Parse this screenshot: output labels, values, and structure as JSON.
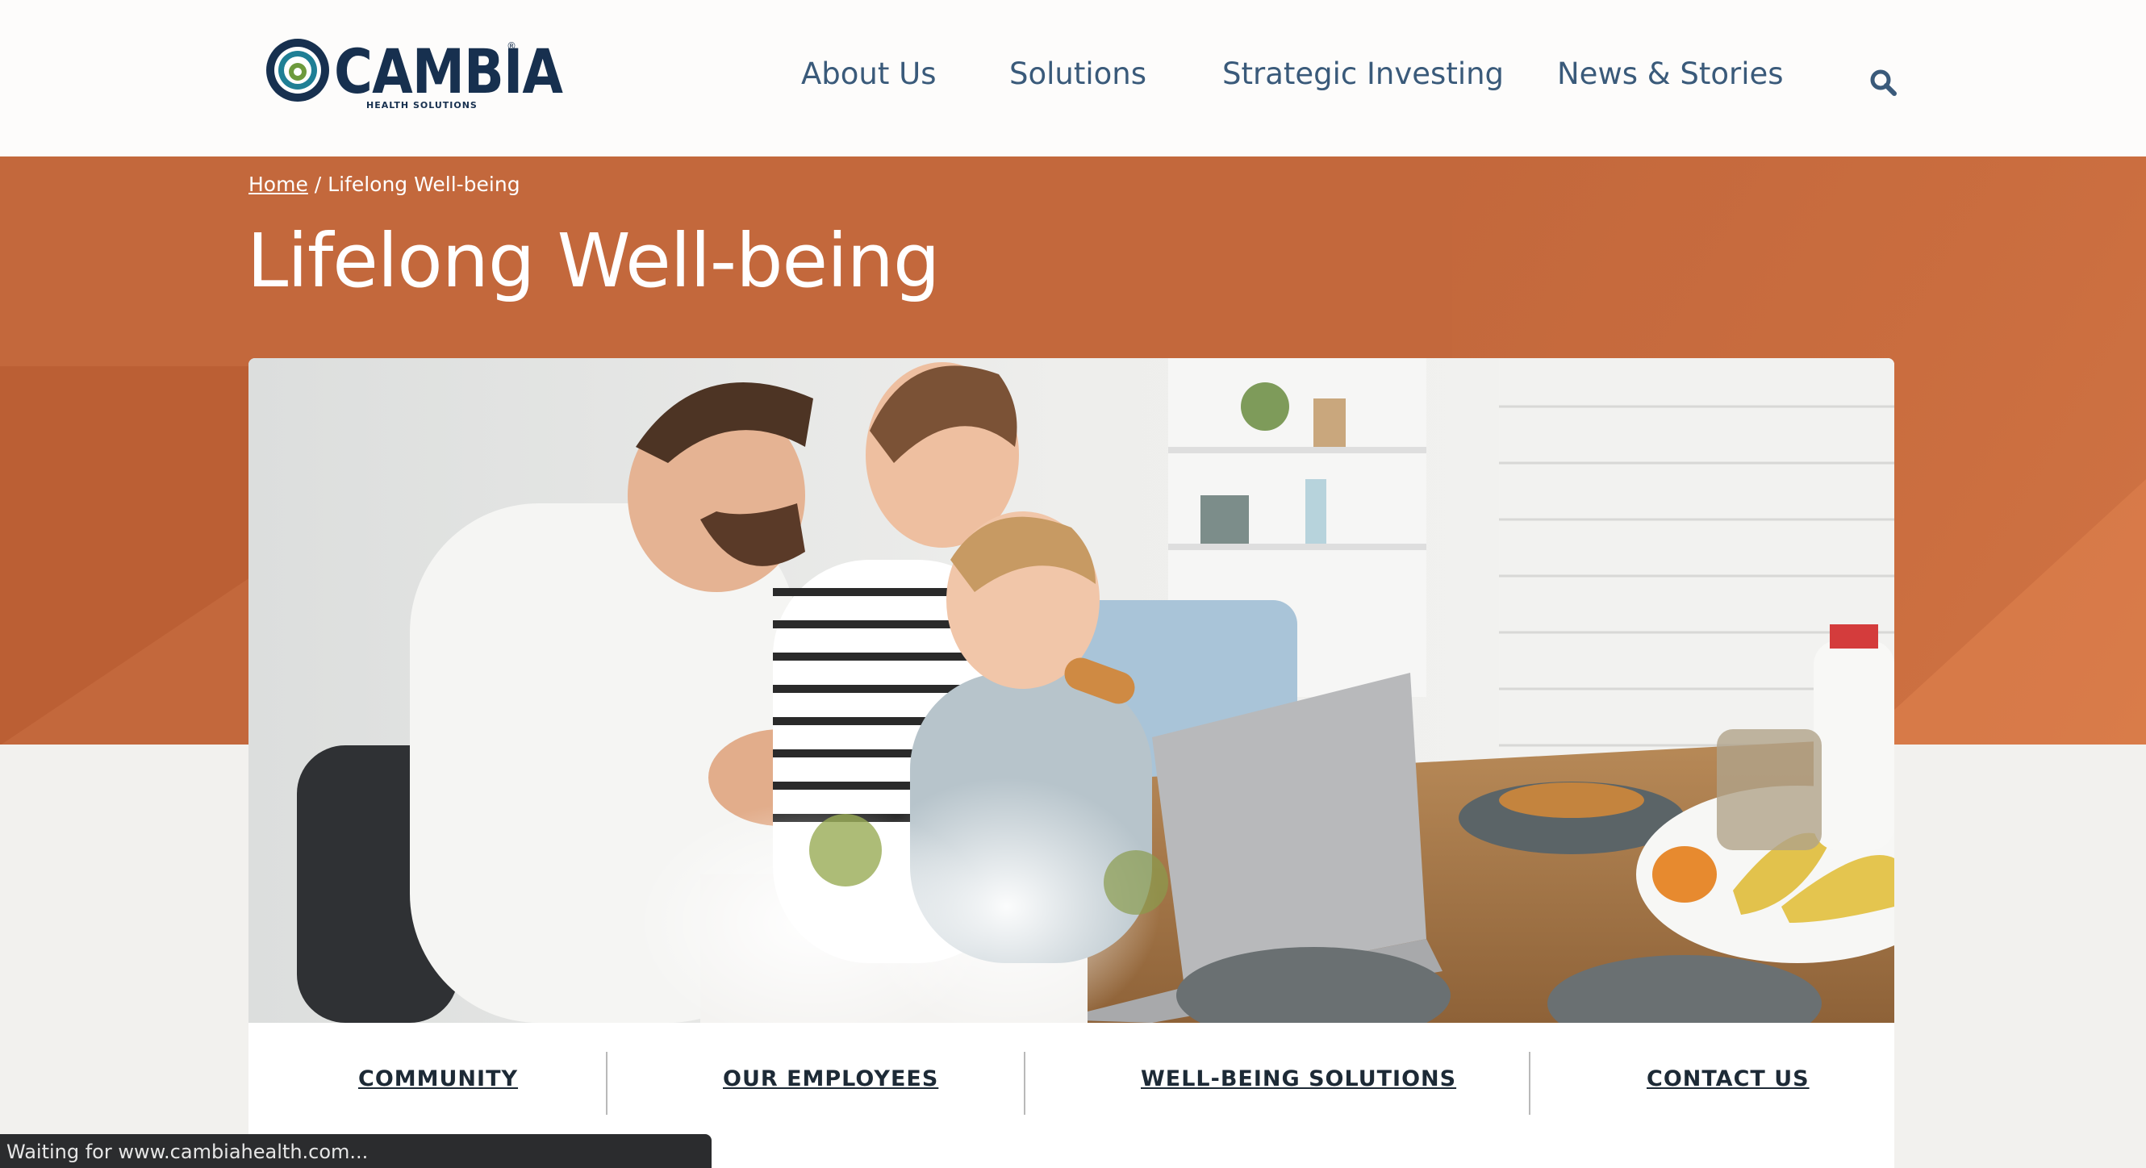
{
  "brand": {
    "name": "CAMBIA",
    "registered": "®",
    "tagline": "HEALTH SOLUTIONS",
    "colors": {
      "navy": "#17304f",
      "teal": "#1f7f95",
      "green": "#6d9a3d",
      "accent": "#c3683c"
    }
  },
  "nav": {
    "items": [
      {
        "label": "About Us"
      },
      {
        "label": "Solutions"
      },
      {
        "label": "Strategic Investing"
      },
      {
        "label": "News & Stories"
      }
    ],
    "search_icon": "search-icon"
  },
  "breadcrumb": {
    "home": "Home",
    "separator": " / ",
    "current": "Lifelong Well-being"
  },
  "page": {
    "title": "Lifelong Well-being"
  },
  "subnav": {
    "items": [
      {
        "label": "COMMUNITY"
      },
      {
        "label": "OUR EMPLOYEES"
      },
      {
        "label": "WELL-BEING SOLUTIONS"
      },
      {
        "label": "CONTACT US"
      }
    ]
  },
  "status": {
    "text": "Waiting for www.cambiahealth.com..."
  }
}
